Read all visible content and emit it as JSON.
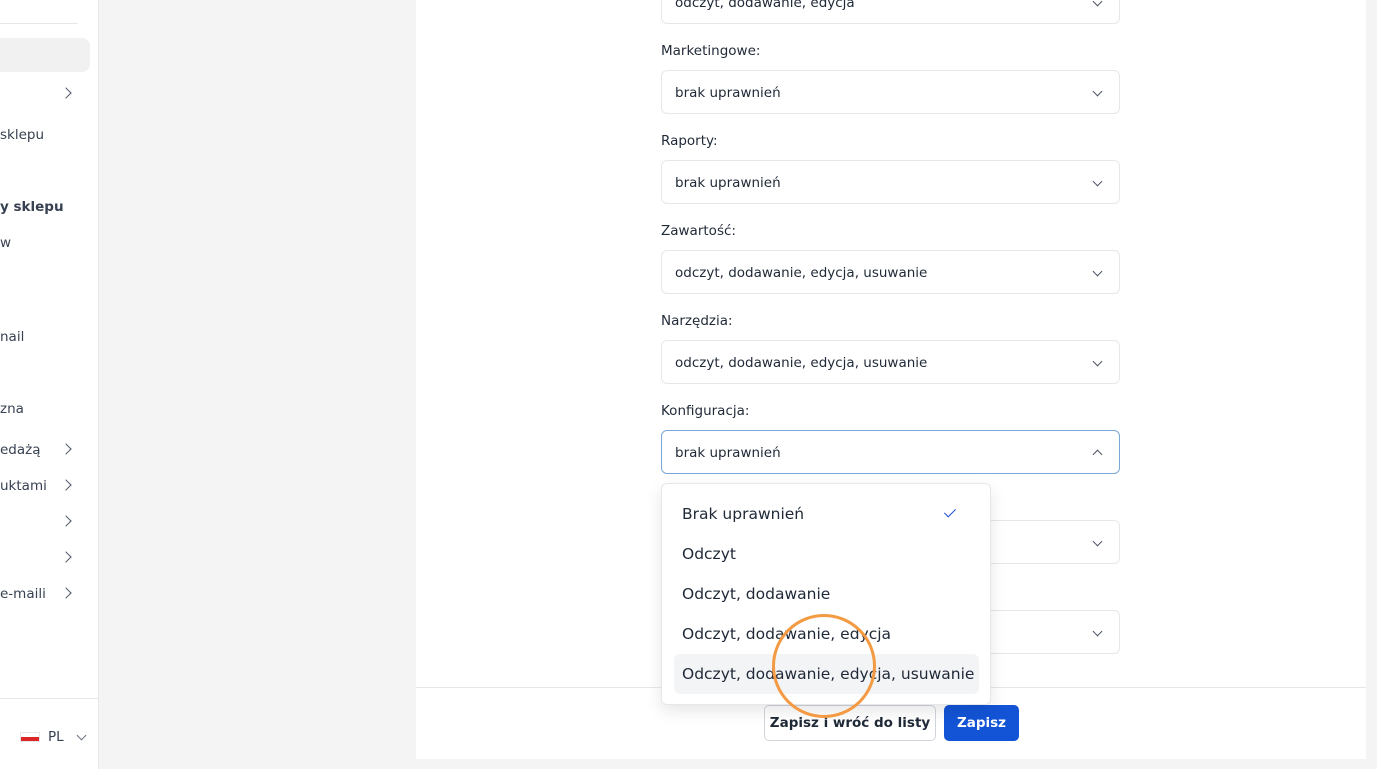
{
  "sidebar": {
    "items": [
      {
        "label": "sklepu"
      },
      {
        "label": "y sklepu"
      },
      {
        "label": "w"
      },
      {
        "label": "nail"
      },
      {
        "label": "zna"
      },
      {
        "label": "edażą"
      },
      {
        "label": "uktami"
      },
      {
        "label": "e-maili"
      }
    ],
    "language": "PL"
  },
  "form": {
    "partial_value": "odczyt, dodawanie, edycja",
    "fields": [
      {
        "label": "Marketingowe:",
        "value": "brak uprawnień"
      },
      {
        "label": "Raporty:",
        "value": "brak uprawnień"
      },
      {
        "label": "Zawartość:",
        "value": "odczyt, dodawanie, edycja, usuwanie"
      },
      {
        "label": "Narzędzia:",
        "value": "odczyt, dodawanie, edycja, usuwanie"
      },
      {
        "label": "Konfiguracja:",
        "value": "brak uprawnień"
      }
    ]
  },
  "dropdown": {
    "options": [
      {
        "label": "Brak uprawnień"
      },
      {
        "label": "Odczyt"
      },
      {
        "label": "Odczyt, dodawanie"
      },
      {
        "label": "Odczyt, dodawanie, edycja"
      },
      {
        "label": "Odczyt, dodawanie, edycja, usuwanie"
      }
    ],
    "selected_index": 0,
    "hovered_index": 4
  },
  "footer": {
    "save_and_back_label": "Zapisz i wróć do listy",
    "save_label": "Zapisz"
  },
  "colors": {
    "primary": "#1354d6",
    "focus_border": "#7aa7d6",
    "click_indicator": "#f39a43"
  }
}
